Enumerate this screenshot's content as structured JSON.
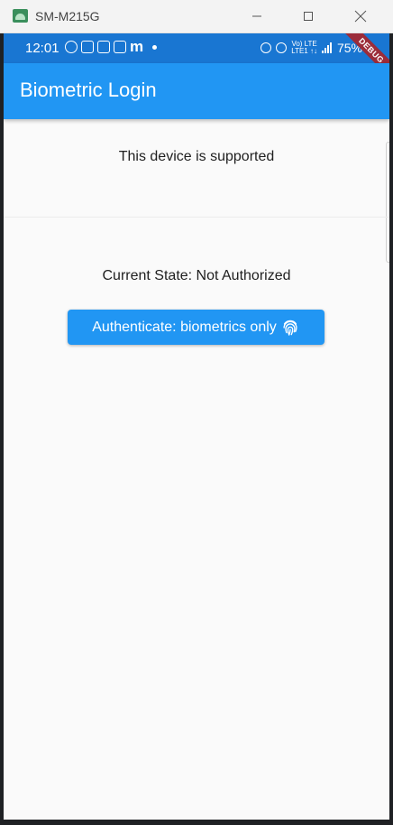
{
  "window": {
    "title": "SM-M215G"
  },
  "status_bar": {
    "time": "12:01",
    "left_icons": [
      "whatsapp-icon",
      "linkedin-icon",
      "wifi-app-icon",
      "outlook-icon",
      "m-app-icon",
      "dot-icon"
    ],
    "m_glyph": "m",
    "lte_label_top": "Vo) LTE",
    "lte_label_bottom": "LTE1 ↑↓",
    "battery": "75%",
    "debug_banner": "DEBUG"
  },
  "app_bar": {
    "title": "Biometric Login"
  },
  "content": {
    "support_text": "This device is supported",
    "current_state": "Current State: Not Authorized",
    "auth_button_label": "Authenticate: biometrics only"
  },
  "colors": {
    "status_bar": "#1976d2",
    "app_bar": "#2196f3",
    "button": "#2196f3",
    "background": "#fafafa"
  }
}
